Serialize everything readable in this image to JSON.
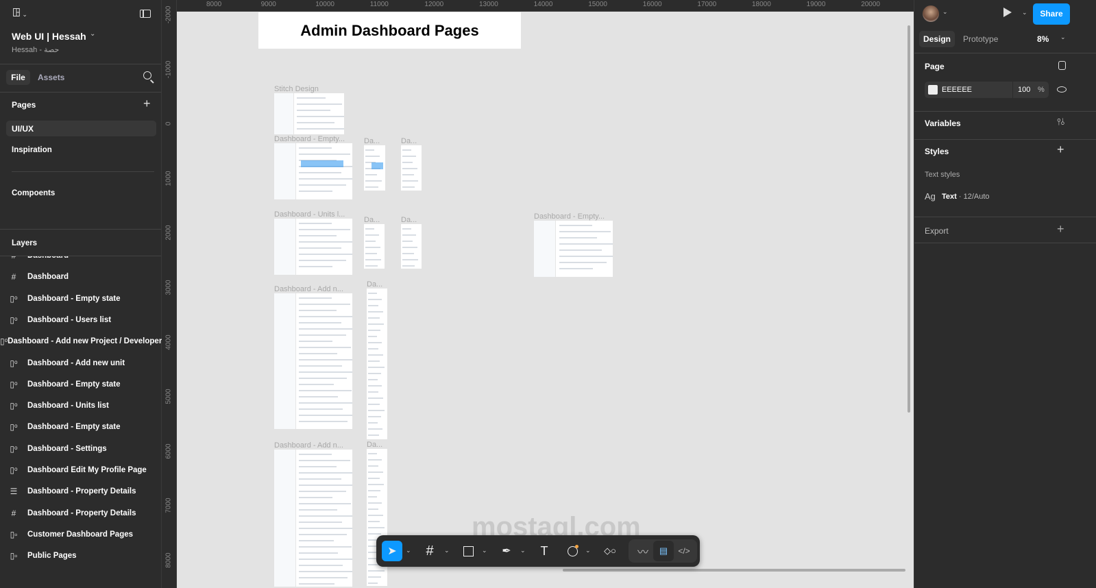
{
  "file": {
    "name": "Web UI | Hessah",
    "owner": "Hessah - حصة"
  },
  "left_tabs": {
    "file": "File",
    "assets": "Assets"
  },
  "pages": {
    "heading": "Pages",
    "items": [
      "UI/UX",
      "Inspiration",
      "Compoents"
    ]
  },
  "layers": {
    "heading": "Layers",
    "items": [
      {
        "icon": "frame",
        "label": "Dashboard"
      },
      {
        "icon": "frame",
        "label": "Dashboard"
      },
      {
        "icon": "component",
        "label": "Dashboard - Empty state"
      },
      {
        "icon": "component",
        "label": "Dashboard - Users list"
      },
      {
        "icon": "component",
        "label": "Dashboard - Add new Project / Developer"
      },
      {
        "icon": "component",
        "label": "Dashboard - Add new unit"
      },
      {
        "icon": "component",
        "label": "Dashboard - Empty state"
      },
      {
        "icon": "component",
        "label": "Dashboard - Units list"
      },
      {
        "icon": "component",
        "label": "Dashboard - Empty state"
      },
      {
        "icon": "component",
        "label": "Dashboard - Settings"
      },
      {
        "icon": "component",
        "label": "Dashboard Edit My Profile Page"
      },
      {
        "icon": "auto-layout",
        "label": "Dashboard - Property Details"
      },
      {
        "icon": "frame",
        "label": "Dashboard - Property Details"
      },
      {
        "icon": "section",
        "label": "Customer Dashboard Pages"
      },
      {
        "icon": "section",
        "label": "Public Pages"
      }
    ]
  },
  "rulers": {
    "horizontal": [
      "8000",
      "9000",
      "10000",
      "11000",
      "12000",
      "13000",
      "14000",
      "15000",
      "16000",
      "17000",
      "18000",
      "19000",
      "20000"
    ],
    "vertical": [
      "-2000",
      "-1000",
      "0",
      "1000",
      "2000",
      "3000",
      "4000",
      "5000",
      "6000",
      "7000",
      "8000"
    ]
  },
  "canvas": {
    "title": "Admin Dashboard Pages",
    "frames": [
      "Stitch Design",
      "Dashboard - Empty...",
      "Da...",
      "Da...",
      "Dashboard - Units l...",
      "Da...",
      "Da...",
      "Dashboard - Empty...",
      "Dashboard - Add n...",
      "Da...",
      "Dashboard - Add n...",
      "Da..."
    ],
    "watermark": "mostaql.com"
  },
  "right": {
    "share": "Share",
    "tabs": {
      "design": "Design",
      "prototype": "Prototype"
    },
    "zoom": "8%",
    "page": {
      "heading": "Page",
      "color": "EEEEEE",
      "opacity": "100",
      "pct": "%"
    },
    "variables": "Variables",
    "styles": {
      "heading": "Styles",
      "text_styles": "Text styles",
      "ag": "Ag",
      "style_name": "Text",
      "style_meta": " · 12/Auto"
    },
    "export": "Export"
  },
  "help": "?",
  "colors": {
    "accent": "#0d99ff",
    "panel": "#2c2c2c",
    "canvas": "#e3e3e3"
  }
}
